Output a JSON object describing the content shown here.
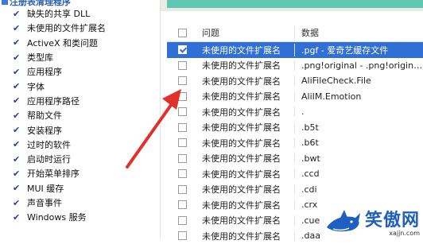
{
  "left_panel": {
    "header": "注册表清理程序",
    "items": [
      {
        "label": "缺失的共享 DLL",
        "checked": true
      },
      {
        "label": "未使用的文件扩展名",
        "checked": true
      },
      {
        "label": "ActiveX 和类问题",
        "checked": true
      },
      {
        "label": "类型库",
        "checked": true
      },
      {
        "label": "应用程序",
        "checked": true
      },
      {
        "label": "字体",
        "checked": true
      },
      {
        "label": "应用程序路径",
        "checked": true
      },
      {
        "label": "帮助文件",
        "checked": true
      },
      {
        "label": "安装程序",
        "checked": true
      },
      {
        "label": "过时的软件",
        "checked": true
      },
      {
        "label": "启动时运行",
        "checked": true
      },
      {
        "label": "开始菜单排序",
        "checked": true
      },
      {
        "label": "MUI 缓存",
        "checked": true
      },
      {
        "label": "声音事件",
        "checked": true
      },
      {
        "label": "Windows 服务",
        "checked": true
      }
    ]
  },
  "table": {
    "columns": {
      "problem": "问题",
      "data": "数据"
    },
    "rows": [
      {
        "problem": "未使用的文件扩展名",
        "data": ".pgf - 爱奇艺缓存文件",
        "selected": true
      },
      {
        "problem": "未使用的文件扩展名",
        "data": ".png!original - .png!original_aut...",
        "selected": false
      },
      {
        "problem": "未使用的文件扩展名",
        "data": "AliFileCheck.File",
        "selected": false
      },
      {
        "problem": "未使用的文件扩展名",
        "data": "AliIM.Emotion",
        "selected": false
      },
      {
        "problem": "未使用的文件扩展名",
        "data": ".",
        "selected": false
      },
      {
        "problem": "未使用的文件扩展名",
        "data": ".b5t",
        "selected": false
      },
      {
        "problem": "未使用的文件扩展名",
        "data": ".b6t",
        "selected": false
      },
      {
        "problem": "未使用的文件扩展名",
        "data": ".bwt",
        "selected": false
      },
      {
        "problem": "未使用的文件扩展名",
        "data": ".ccd",
        "selected": false
      },
      {
        "problem": "未使用的文件扩展名",
        "data": ".cdi",
        "selected": false
      },
      {
        "problem": "未使用的文件扩展名",
        "data": ".crx",
        "selected": false
      },
      {
        "problem": "未使用的文件扩展名",
        "data": ".cue",
        "selected": false
      },
      {
        "problem": "未使用的文件扩展名",
        "data": ".daa",
        "selected": false
      }
    ]
  },
  "annotation": {
    "arrow_color": "#e0312b"
  },
  "watermark": {
    "text": "笑傲网",
    "url": "xajjn.com",
    "icon": "shark-logo-icon",
    "color": "#1f5fbf"
  },
  "colors": {
    "selection": "#2f6fd6",
    "check": "#1e3fa8",
    "accent_band": "#5fc7b0"
  }
}
